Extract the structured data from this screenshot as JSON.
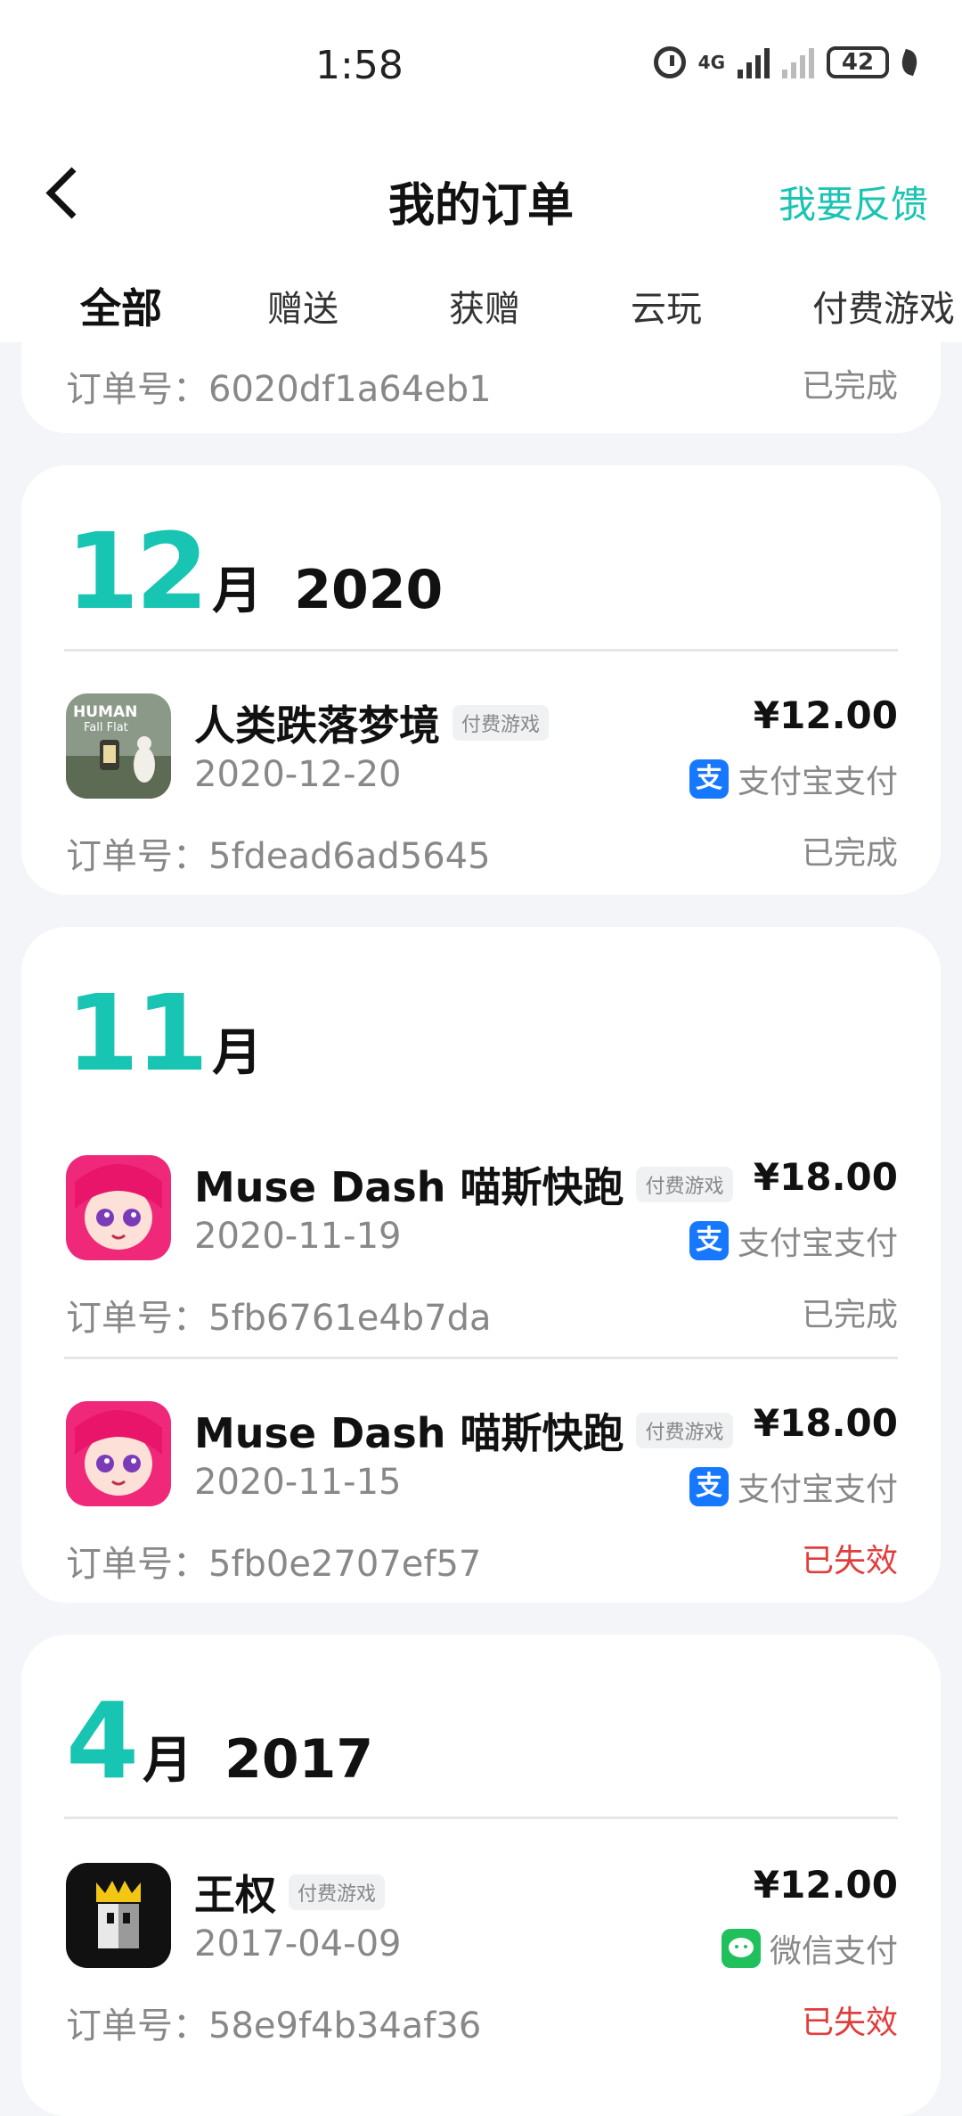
{
  "status_bar": {
    "time": "1:58",
    "network": "4G",
    "battery": "42"
  },
  "header": {
    "title": "我的订单",
    "feedback": "我要反馈"
  },
  "tabs": [
    {
      "label": "全部",
      "active": true
    },
    {
      "label": "赠送"
    },
    {
      "label": "获赠"
    },
    {
      "label": "云玩"
    },
    {
      "label": "付费游戏"
    }
  ],
  "partial_order": {
    "order_no": "订单号：6020df1a64eb1",
    "status": "已完成"
  },
  "groups": [
    {
      "month": "12",
      "month_suffix": "月",
      "year": "2020",
      "orders": [
        {
          "title": "人类跌落梦境",
          "tag": "付费游戏",
          "date": "2020-12-20",
          "price": "¥12.00",
          "pay_method": "支付宝支付",
          "pay_icon": "alipay-icon",
          "order_no": "订单号：5fdead6ad5645",
          "status": "已完成"
        }
      ]
    },
    {
      "month": "11",
      "month_suffix": "月",
      "year": "",
      "orders": [
        {
          "title": "Muse Dash 喵斯快跑",
          "tag": "付费游戏",
          "date": "2020-11-19",
          "price": "¥18.00",
          "pay_method": "支付宝支付",
          "pay_icon": "alipay-icon",
          "order_no": "订单号：5fb6761e4b7da",
          "status": "已完成"
        },
        {
          "title": "Muse Dash 喵斯快跑",
          "tag": "付费游戏",
          "date": "2020-11-15",
          "price": "¥18.00",
          "pay_method": "支付宝支付",
          "pay_icon": "alipay-icon",
          "order_no": "订单号：5fb0e2707ef57",
          "status": "已失效"
        }
      ]
    },
    {
      "month": "4",
      "month_suffix": "月",
      "year": "2017",
      "orders": [
        {
          "title": "王权",
          "tag": "付费游戏",
          "date": "2017-04-09",
          "price": "¥12.00",
          "pay_method": "微信支付",
          "pay_icon": "wechat-pay-icon",
          "order_no": "订单号：58e9f4b34af36",
          "status": "已失效"
        }
      ]
    }
  ],
  "colors": {
    "accent": "#18c4b2",
    "failed": "#e23d3d",
    "alipay": "#1677ff",
    "wechat": "#20c05c"
  }
}
